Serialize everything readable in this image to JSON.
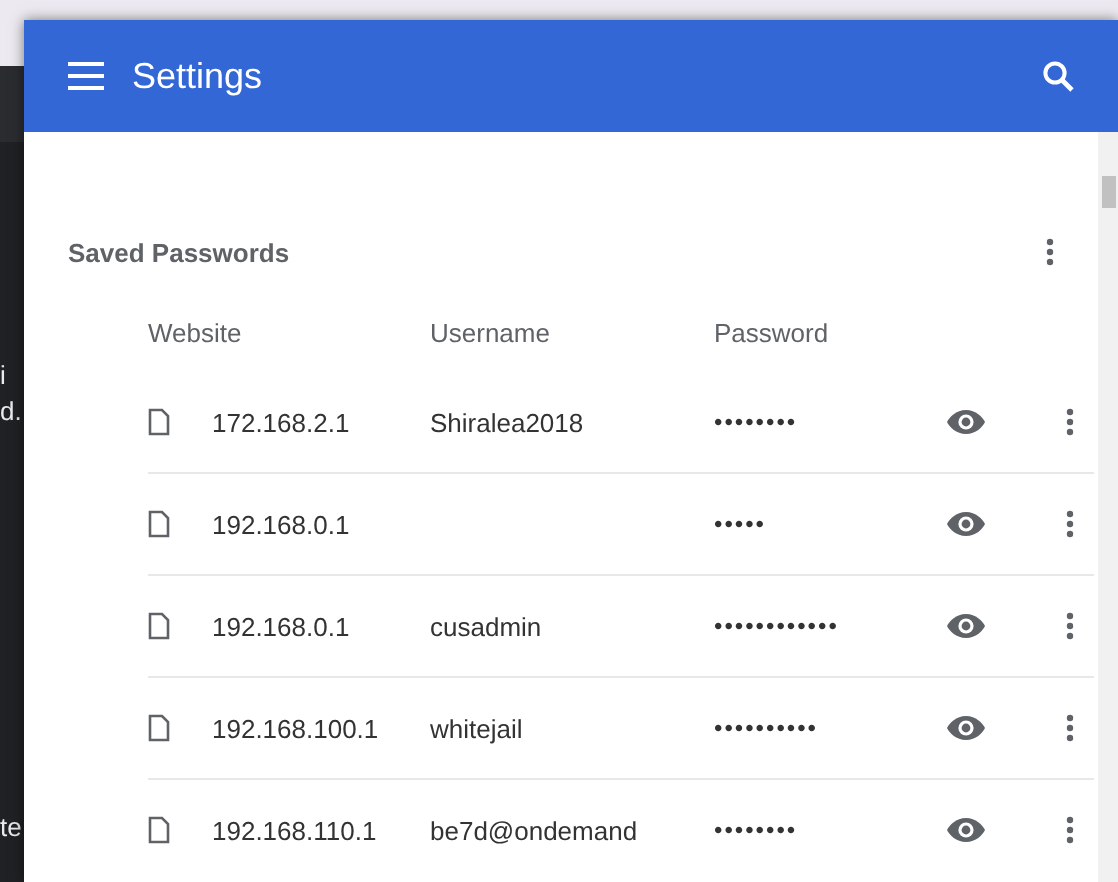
{
  "background_window": {
    "text_fragments": [
      "i",
      "d.",
      "te"
    ]
  },
  "window": {
    "title": "Settings"
  },
  "section": {
    "title": "Saved Passwords"
  },
  "table": {
    "columns": [
      "Website",
      "Username",
      "Password"
    ],
    "rows": [
      {
        "website": "172.168.2.1",
        "username": "Shiralea2018",
        "password": "••••••••"
      },
      {
        "website": "192.168.0.1",
        "password": "•••••"
      },
      {
        "website": "192.168.0.1",
        "username": "cusadmin",
        "password": "••••••••••••"
      },
      {
        "website": "192.168.100.1",
        "username": "whitejail",
        "password": "••••••••••"
      },
      {
        "website": "192.168.110.1",
        "username": "be7d@ondemand",
        "password": "••••••••"
      }
    ]
  }
}
